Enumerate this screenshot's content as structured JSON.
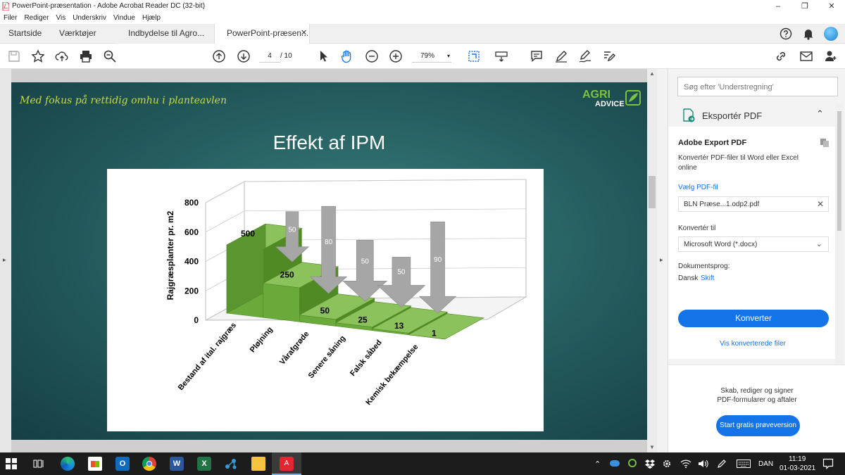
{
  "window": {
    "title": "PowerPoint-præsentation - Adobe Acrobat Reader DC (32-bit)"
  },
  "menu": [
    "Filer",
    "Rediger",
    "Vis",
    "Underskriv",
    "Vindue",
    "Hjælp"
  ],
  "tabs": {
    "home": "Startside",
    "tools": "Værktøjer",
    "doc1": "Indbydelse til Agro...",
    "doc2": "PowerPoint-præsen..."
  },
  "toolbar": {
    "page_current": "4",
    "page_total": "/ 10",
    "zoom": "79%"
  },
  "slide": {
    "slogan": "Med fokus på rettidig omhu i planteavlen",
    "logo_top": "AGRI",
    "logo_bottom": "ADVICE",
    "title": "Effekt af IPM"
  },
  "chart_data": {
    "type": "bar",
    "categories": [
      "Bestand af ital. rajgræs",
      "Pløjning",
      "Vårafgrøde",
      "Senere såning",
      "Falsk såbed",
      "Kemisk bekæmpelse"
    ],
    "series": [
      {
        "values": [
          500,
          250,
          50,
          25,
          13,
          1
        ]
      }
    ],
    "value_labels": [
      "500",
      "250",
      "50",
      "25",
      "13",
      "1"
    ],
    "reduction_arrows": [
      {
        "between": [
          "Bestand af ital. rajgræs",
          "Pløjning"
        ],
        "label": "50"
      },
      {
        "between": [
          "Pløjning",
          "Vårafgrøde"
        ],
        "label": "80"
      },
      {
        "between": [
          "Vårafgrøde",
          "Senere såning"
        ],
        "label": "50"
      },
      {
        "between": [
          "Senere såning",
          "Falsk såbed"
        ],
        "label": "50"
      },
      {
        "between": [
          "Falsk såbed",
          "Kemisk bekæmpelse"
        ],
        "label": "90"
      }
    ],
    "ylabel": "Rajgræsplanter pr. m2",
    "yticks": [
      0,
      200,
      400,
      600,
      800
    ],
    "ylim": [
      0,
      800
    ],
    "grid": true,
    "bar_color": "#6aaa3a"
  },
  "panel": {
    "search_placeholder": "Søg efter 'Understregning'",
    "export_header": "Eksportér PDF",
    "section_title": "Adobe Export PDF",
    "desc_line1": "Konvertér PDF-filer til Word eller Excel",
    "desc_line2": "online",
    "choose_file": "Vælg PDF-fil",
    "file_name": "BLN Præse...1.odp2.pdf",
    "convert_to_label": "Konvertér til",
    "convert_to_value": "Microsoft Word (*.docx)",
    "doc_lang_label": "Dokumentsprog:",
    "doc_lang_value": "Dansk",
    "change_link": "Skift",
    "convert_button": "Konverter",
    "view_converted": "Vis konverterede filer",
    "promo_line1": "Skab, rediger og signer",
    "promo_line2": "PDF-formularer og aftaler",
    "trial_button": "Start gratis prøveversion"
  },
  "taskbar": {
    "lang": "DAN",
    "time": "11:19",
    "date": "01-03-2021"
  },
  "colors": {
    "accent": "#1473e6",
    "slide_bg": "#235a5c",
    "slogan": "#c8d84a"
  }
}
